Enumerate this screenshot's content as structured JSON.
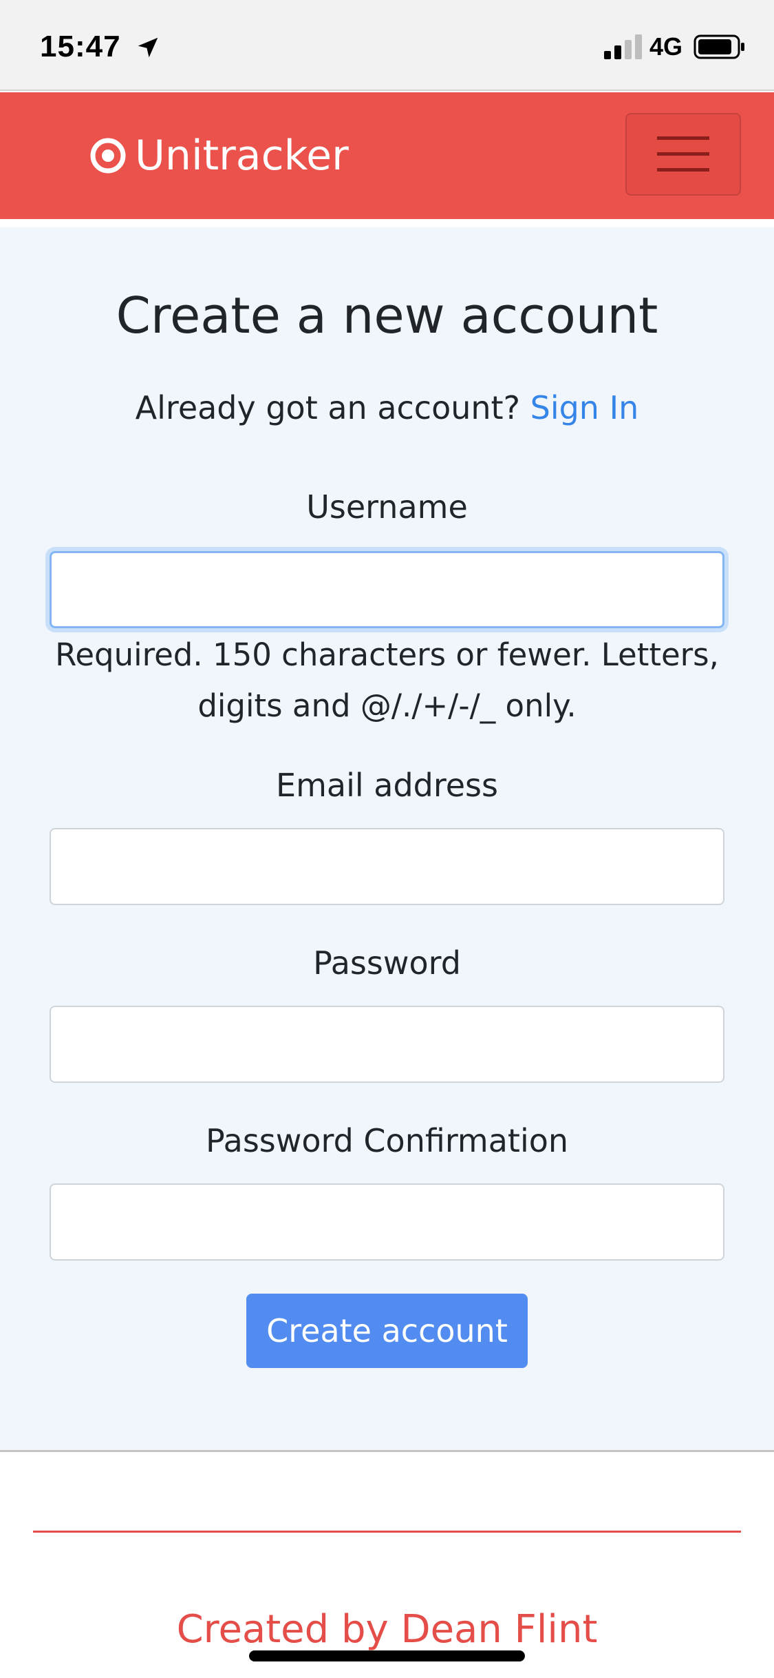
{
  "status_bar": {
    "time": "15:47",
    "network": "4G",
    "icons": [
      "location-arrow-icon",
      "signal-strength-icon",
      "battery-icon"
    ]
  },
  "navbar": {
    "brand": "Unitracker",
    "brand_icon": "target-icon",
    "menu_icon": "hamburger-menu-icon",
    "color": "#eb524c"
  },
  "form": {
    "title": "Create a new account",
    "signin_prompt": "Already got an account?",
    "signin_link": "Sign In",
    "fields": {
      "username": {
        "label": "Username",
        "value": "",
        "help": "Required. 150 characters or fewer. Letters, digits and @/./+/-/_ only."
      },
      "email": {
        "label": "Email address",
        "value": ""
      },
      "password": {
        "label": "Password",
        "value": ""
      },
      "password_confirmation": {
        "label": "Password Confirmation",
        "value": ""
      }
    },
    "submit": "Create account"
  },
  "footer": {
    "credit": "Created by Dean Flint"
  },
  "colors": {
    "accent_red": "#eb524c",
    "link_blue": "#3585e8",
    "button_blue": "#528cf0",
    "card_background": "#f1f6fd"
  }
}
